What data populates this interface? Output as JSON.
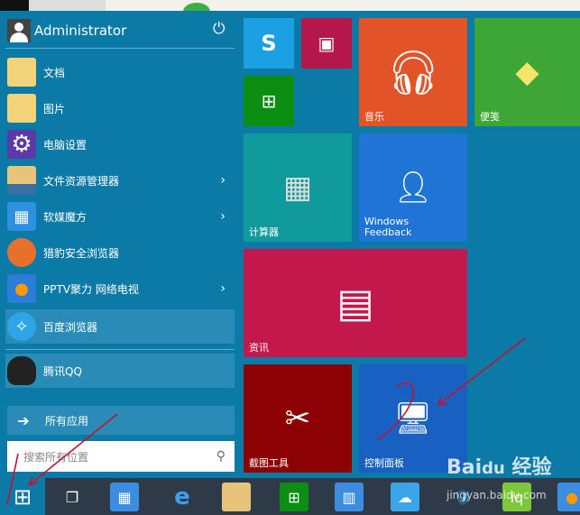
{
  "user": {
    "name": "Administrator",
    "power_icon": "power-icon"
  },
  "left_items": [
    {
      "label": "文档",
      "icon": "documents-folder-icon",
      "chevron": false
    },
    {
      "label": "图片",
      "icon": "pictures-folder-icon",
      "chevron": false
    },
    {
      "label": "电脑设置",
      "icon": "gear-icon",
      "chevron": false
    },
    {
      "label": "文件资源管理器",
      "icon": "file-explorer-icon",
      "chevron": true
    },
    {
      "label": "软媒魔方",
      "icon": "ruanmei-cube-icon",
      "chevron": true
    },
    {
      "label": "猎豹安全浏览器",
      "icon": "liebao-browser-icon",
      "chevron": false
    },
    {
      "label": "PPTV聚力 网络电视",
      "icon": "pptv-icon",
      "chevron": true
    },
    {
      "label": "百度浏览器",
      "icon": "baidu-browser-icon",
      "chevron": false
    },
    {
      "label": "腾讯QQ",
      "icon": "qq-penguin-icon",
      "chevron": false
    }
  ],
  "all_apps": {
    "label": "所有应用"
  },
  "search": {
    "placeholder": "搜索所有位置"
  },
  "tiles": [
    {
      "id": "skype",
      "label": "",
      "color": "#1ba1e2"
    },
    {
      "id": "video",
      "label": "",
      "color": "#b5174a"
    },
    {
      "id": "store",
      "label": "",
      "color": "#0b8e12"
    },
    {
      "id": "music",
      "label": "音乐",
      "color": "#e35328"
    },
    {
      "id": "sticky-notes",
      "label": "便笺",
      "color": "#3ea637"
    },
    {
      "id": "calculator",
      "label": "计算器",
      "color": "#119a9c"
    },
    {
      "id": "windows-feedback",
      "label": "Windows\nFeedback",
      "color": "#1f74d6"
    },
    {
      "id": "news",
      "label": "资讯",
      "color": "#c3184b"
    },
    {
      "id": "snipping-tool",
      "label": "截图工具",
      "color": "#8c0104"
    },
    {
      "id": "control-panel",
      "label": "控制面板",
      "color": "#1860c2"
    }
  ],
  "taskbar": [
    "start",
    "task-view",
    "ruanmei",
    "internet-explorer",
    "file-explorer",
    "store",
    "cube",
    "baidu-cloud",
    "security",
    "iqiyi",
    "pptv"
  ],
  "watermark": {
    "logo": "Bai du 经验",
    "url": "jingyan.baidu.com"
  }
}
